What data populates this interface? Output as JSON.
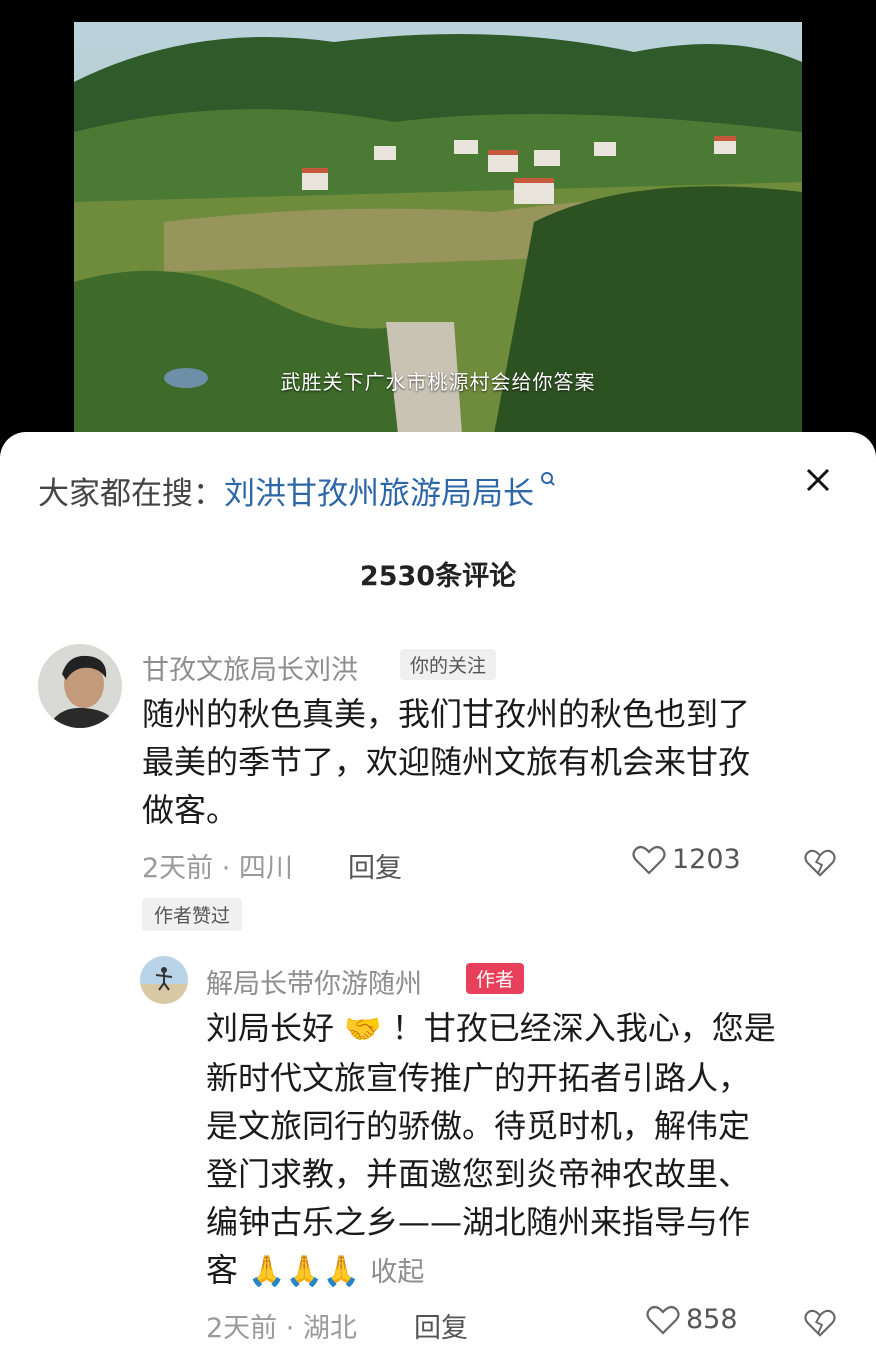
{
  "video": {
    "subtitle": "武胜关下广水市桃源村会给你答案"
  },
  "search": {
    "prefix": "大家都在搜：",
    "term": "刘洪甘孜州旅游局局长"
  },
  "comments_header": {
    "count_label": "2530条评论"
  },
  "comment": {
    "username": "甘孜文旅局长刘洪",
    "badge": "你的关注",
    "lines": [
      "随州的秋色真美，我们甘孜州的秋色也到了",
      "最美的季节了，欢迎随州文旅有机会来甘孜",
      "做客。"
    ],
    "meta": "2天前 · 四川",
    "reply_label": "回复",
    "likes": "1203",
    "liked_by_author": "作者赞过"
  },
  "reply": {
    "username": "解局长带你游随州",
    "badge": "作者",
    "line1_before": "刘局长好",
    "line1_emoji": "🤝",
    "line1_after": "！甘孜已经深入我心，您是",
    "lines": [
      "新时代文旅宣传推广的开拓者引路人，",
      "是文旅同行的骄傲。待觅时机，解伟定",
      "登门求教，并面邀您到炎帝神农故里、",
      "编钟古乐之乡——湖北随州来指导与作"
    ],
    "last_line_text": "客",
    "last_line_emojis": "🙏🙏🙏",
    "collapse_label": "收起",
    "meta": "2天前 · 湖北",
    "reply_label": "回复",
    "likes": "858"
  }
}
